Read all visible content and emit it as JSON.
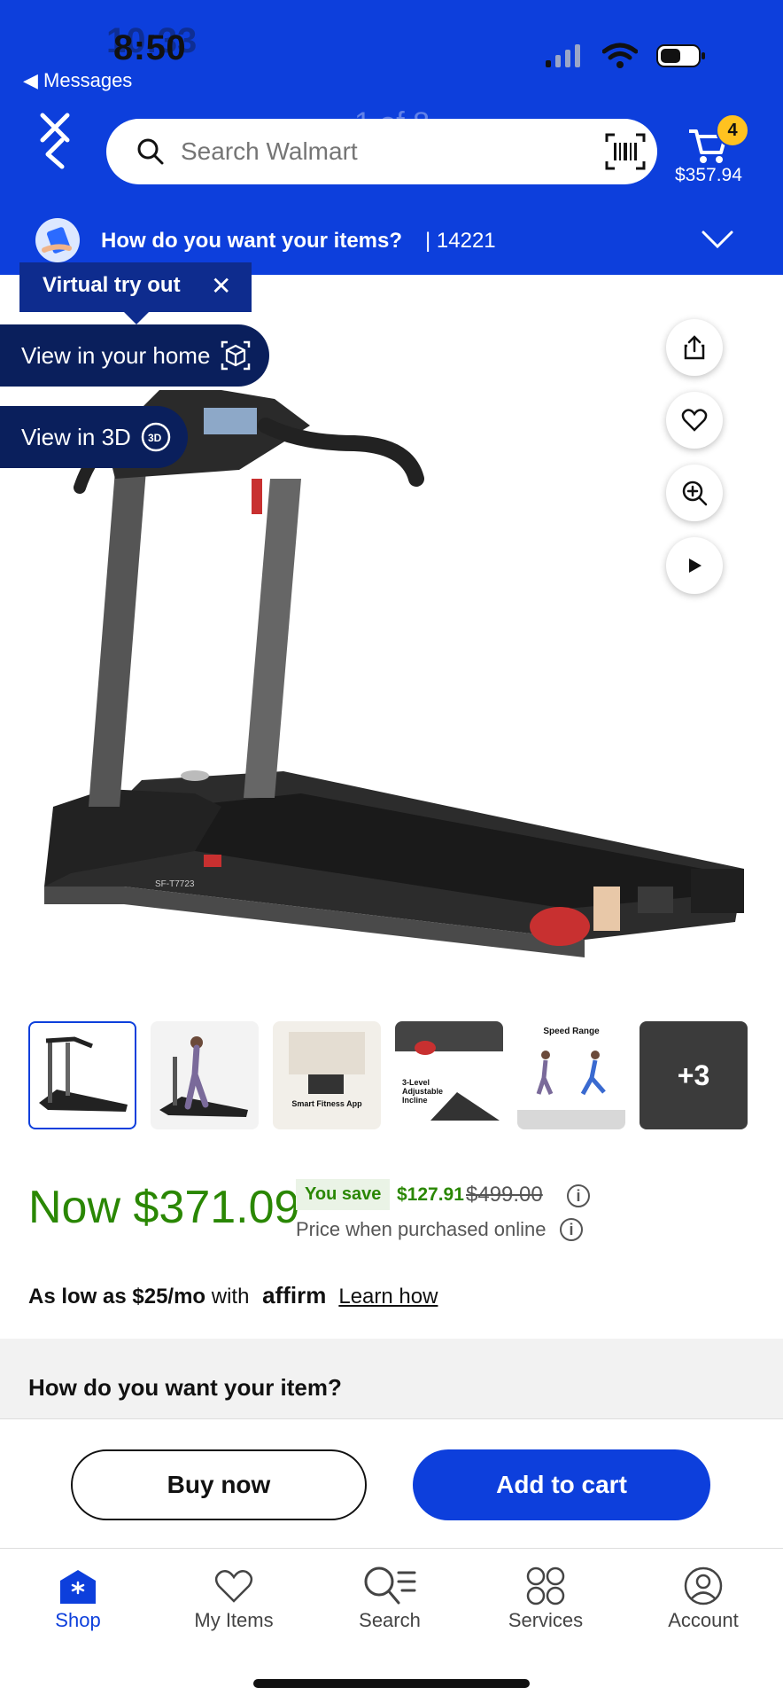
{
  "status": {
    "time": "8:50",
    "time_overlay": "10:33",
    "back_app": "◀ Messages"
  },
  "header": {
    "page_counter": "1 of 8",
    "search_placeholder": "Search Walmart",
    "cart_count": "4",
    "cart_total": "$357.94",
    "delivery_question": "How do you want your items?",
    "delivery_zip": "| 14221"
  },
  "product": {
    "virtual_try_out": "Virtual try out",
    "view_in_home": "View in your home",
    "view_in_3d": "View in 3D",
    "extra_thumbs": "+3",
    "thumb_labels": {
      "t3": "Smart Fitness App",
      "t4": "3-Level Adjustable Incline",
      "t5": "Speed Range"
    }
  },
  "pricing": {
    "now": "Now $371.09",
    "you_save_label": "You save",
    "save_amount": "$127.91",
    "was_price": "$499.00",
    "online_note": "Price when purchased online"
  },
  "financing": {
    "as_low_as": "As low as $25/mo",
    "with": " with ",
    "provider": "affirm",
    "learn": "Learn how"
  },
  "fulfillment": {
    "title": "How do you want your item?"
  },
  "actions": {
    "buy_now": "Buy now",
    "add_to_cart": "Add to cart"
  },
  "tabs": [
    {
      "label": "Shop",
      "icon": "shop-icon"
    },
    {
      "label": "My Items",
      "icon": "heart-icon"
    },
    {
      "label": "Search",
      "icon": "search-list-icon"
    },
    {
      "label": "Services",
      "icon": "services-icon"
    },
    {
      "label": "Account",
      "icon": "account-icon"
    }
  ],
  "colors": {
    "brand_blue": "#0d3fdc",
    "price_green": "#2a8703",
    "badge_yellow": "#ffc220"
  }
}
